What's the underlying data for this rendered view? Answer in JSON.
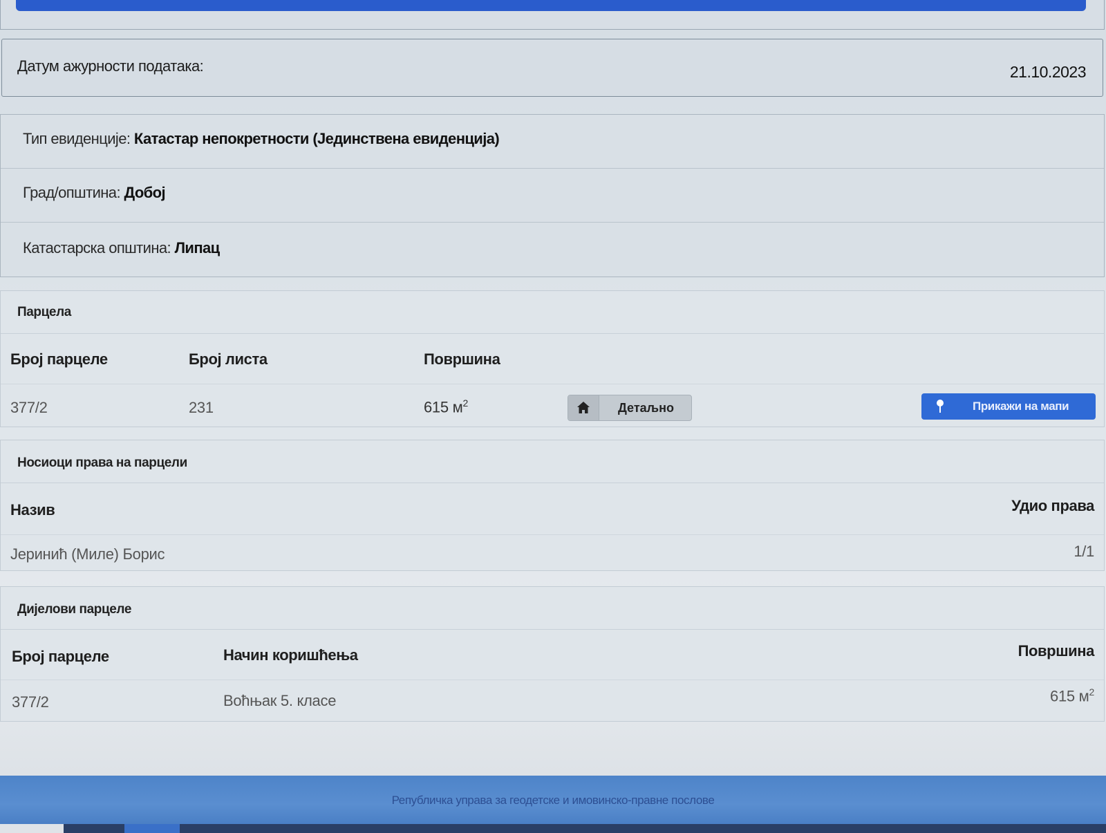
{
  "date_panel": {
    "label": "Датум ажурности података:",
    "value": "21.10.2023"
  },
  "info": {
    "type_label": "Тип евиденције:",
    "type_value": "Катастар непокретности (Јединствена евиденција)",
    "city_label": "Град/општина:",
    "city_value": "Добој",
    "cadastral_label": "Катастарска општина:",
    "cadastral_value": "Липац"
  },
  "parcel": {
    "title": "Парцела",
    "headers": {
      "number": "Број парцеле",
      "sheet": "Број листа",
      "area": "Површина"
    },
    "row": {
      "number": "377/2",
      "sheet": "231",
      "area": "615 м",
      "area_sup": "2"
    },
    "detail_button": "Детаљно",
    "map_button": "Прикажи на мапи"
  },
  "owners": {
    "title": "Носиоци права на парцели",
    "headers": {
      "name": "Назив",
      "share": "Удио права"
    },
    "row": {
      "name": "Јеринић (Миле) Борис",
      "share": "1/1"
    }
  },
  "parts": {
    "title": "Дијелови парцеле",
    "headers": {
      "number": "Број парцеле",
      "usage": "Начин коришћења",
      "area": "Површина"
    },
    "row": {
      "number": "377/2",
      "usage": "Воћњак 5. класе",
      "area": "615 м",
      "area_sup": "2"
    }
  },
  "footer": {
    "text": "Републичка управа за геодетске и имовинско-правне послове"
  },
  "colors": {
    "accent": "#2f6ad6",
    "footer": "#5a8ed0"
  },
  "icons": {
    "detail": "home-icon",
    "map": "map-marker-icon"
  }
}
